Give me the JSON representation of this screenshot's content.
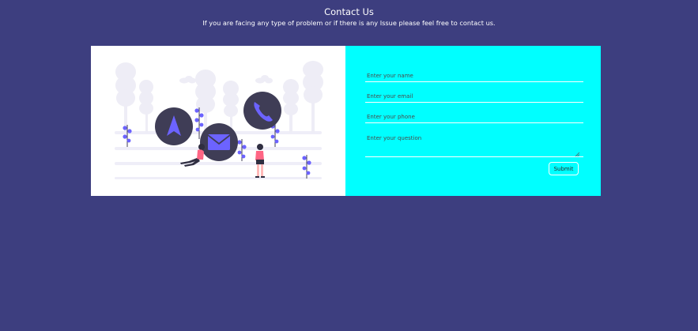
{
  "header": {
    "title": "Contact Us",
    "subtitle": "If you are facing any type of problem or if there is any Issue please feel free to contact us."
  },
  "form": {
    "name_placeholder": "Enter your name",
    "email_placeholder": "Enter your email",
    "phone_placeholder": "Enter your phone",
    "question_placeholder": "Enter your question",
    "submit_label": "Submit"
  },
  "colors": {
    "page_background": "#3d3e7f",
    "form_background": "#00ffff",
    "illustration_accent": "#6c63ff",
    "icon_circle": "#3f3d56"
  },
  "illustration": {
    "icons": [
      "navigation-arrow-icon",
      "envelope-icon",
      "phone-icon"
    ]
  }
}
